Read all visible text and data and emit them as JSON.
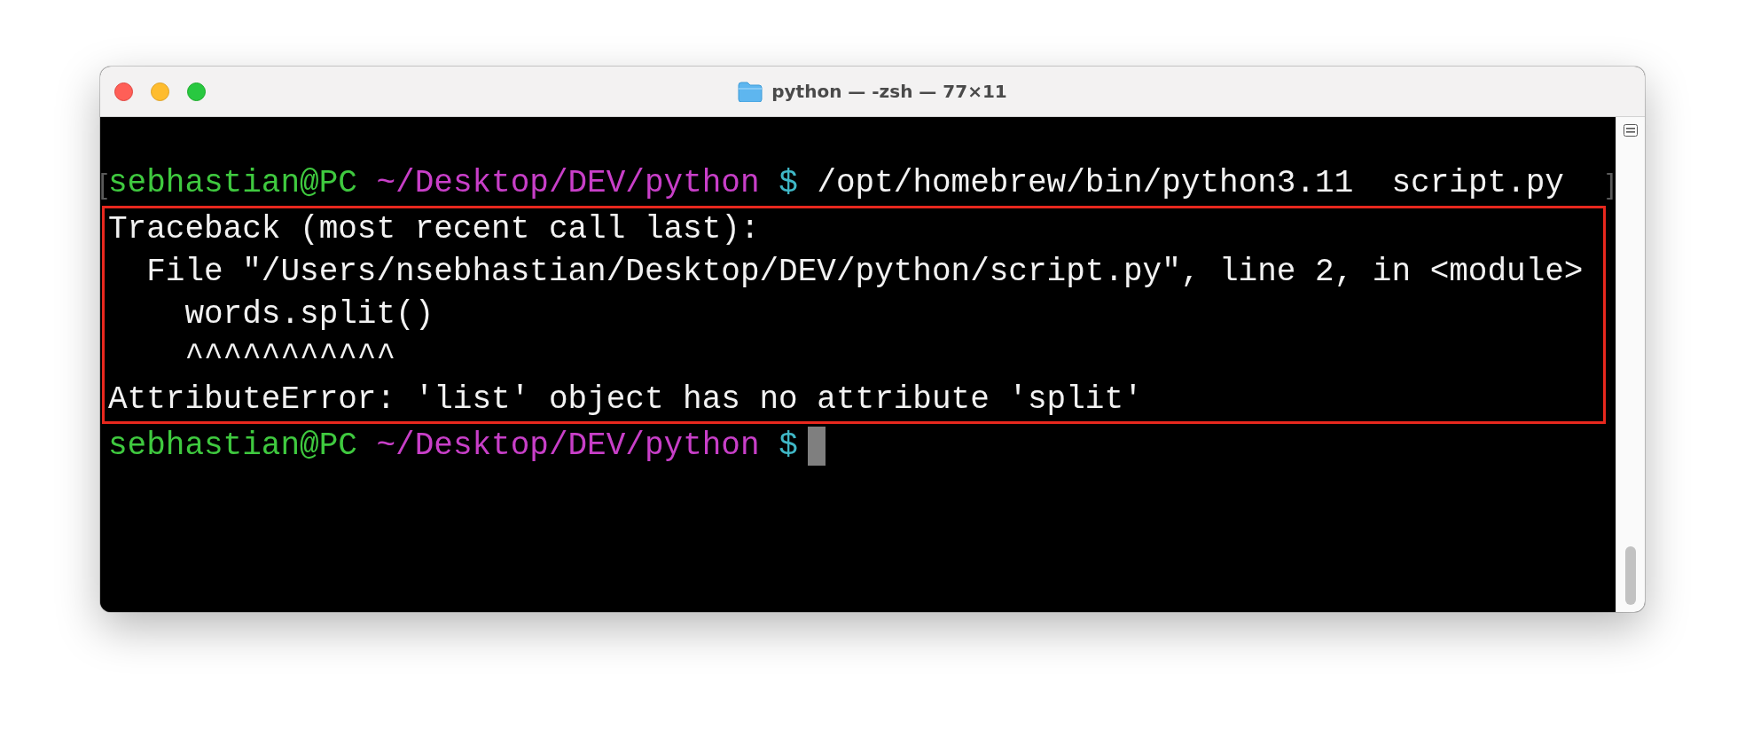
{
  "window": {
    "title": "python — -zsh — 77×11"
  },
  "terminal": {
    "blocks": [
      {
        "kind": "prompt",
        "user": "sebhastian@PC",
        "path": "~/Desktop/DEV/python",
        "symbol": "$",
        "command": "/opt/homebrew/bin/python3.11  script.py",
        "mark_open": "[",
        "mark_close": "]"
      },
      {
        "kind": "output",
        "highlighted": true,
        "lines": [
          "Traceback (most recent call last):",
          "  File \"/Users/nsebhastian/Desktop/DEV/python/script.py\", line 2, in <module>",
          "    words.split()",
          "    ^^^^^^^^^^^",
          "AttributeError: 'list' object has no attribute 'split'"
        ]
      },
      {
        "kind": "prompt",
        "user": "sebhastian@PC",
        "path": "~/Desktop/DEV/python",
        "symbol": "$",
        "cursor": true
      }
    ]
  }
}
